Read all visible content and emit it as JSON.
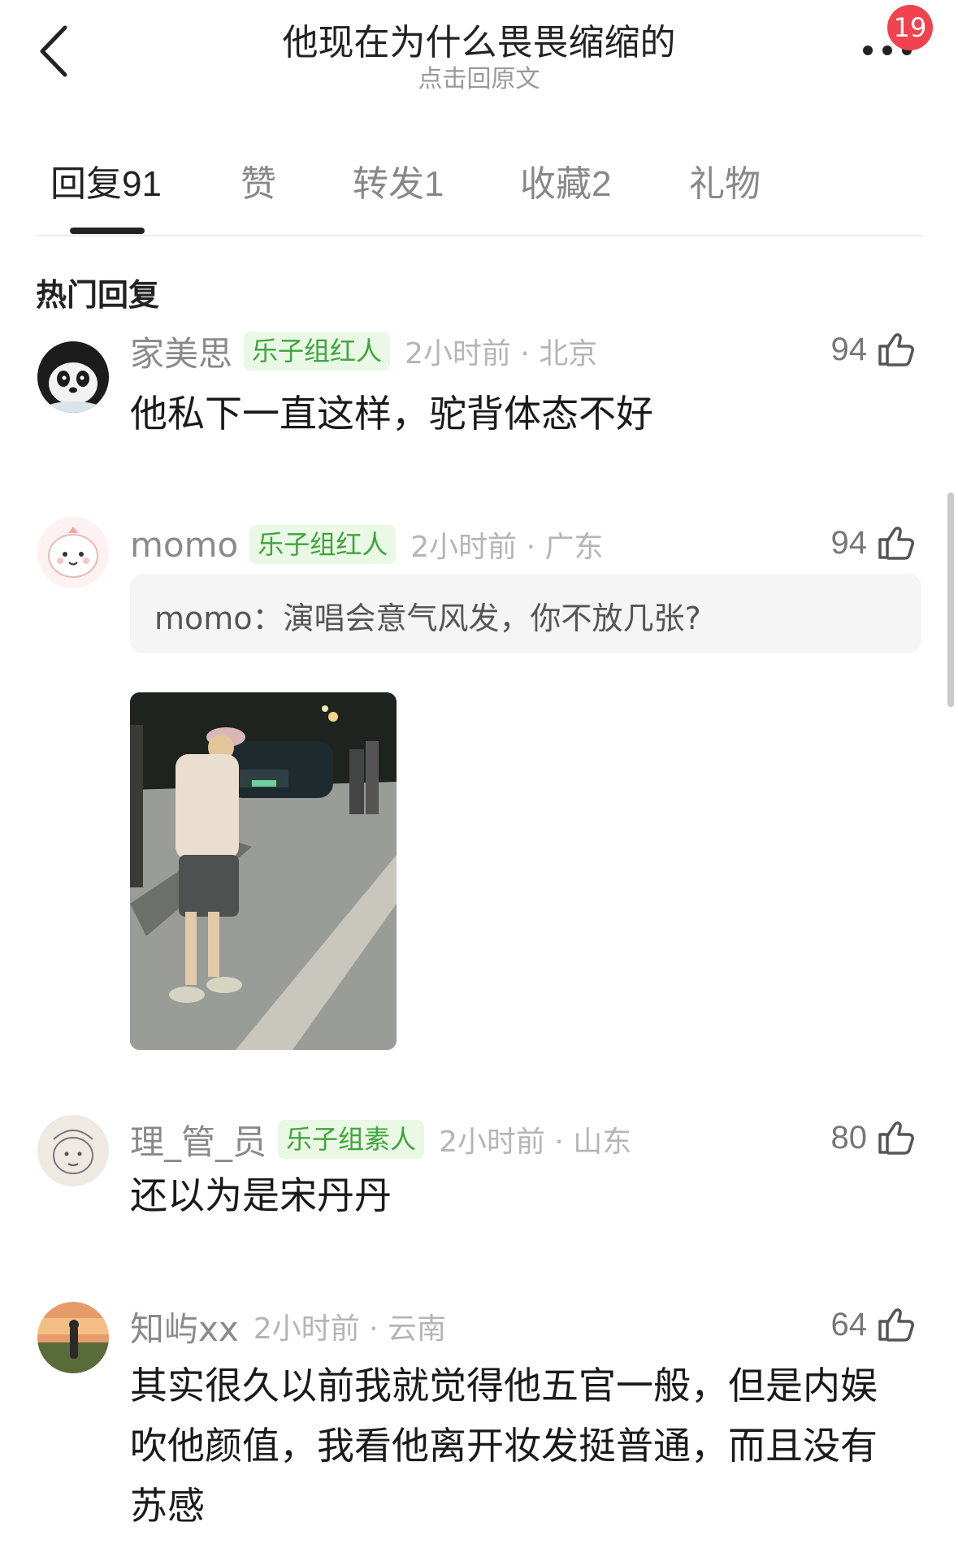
{
  "header": {
    "back_icon": "chevron-left-icon",
    "title": "他现在为什么畏畏缩缩的",
    "subtitle": "点击回原文",
    "more_icon": "more-dots-icon",
    "badge_count": "19"
  },
  "tabs": [
    {
      "label": "回复",
      "count": "91",
      "active": true
    },
    {
      "label": "赞",
      "count": "",
      "active": false
    },
    {
      "label": "转发",
      "count": "1",
      "active": false
    },
    {
      "label": "收藏",
      "count": "2",
      "active": false
    },
    {
      "label": "礼物",
      "count": "",
      "active": false
    }
  ],
  "section_title": "热门回复",
  "comments": [
    {
      "username": "家美思",
      "tag": "乐子组红人",
      "time_location": "2小时前 · 北京",
      "likes": "94",
      "text": "他私下一直这样，驼背体态不好",
      "avatar_icon": "panda-avatar"
    },
    {
      "username": "momo",
      "tag": "乐子组红人",
      "time_location": "2小时前 · 广东",
      "likes": "94",
      "quote": "momo：演唱会意气风发，你不放几张?",
      "avatar_icon": "cartoon-avatar",
      "photo": "street-photo"
    },
    {
      "username": "理_管_员",
      "tag": "乐子组素人",
      "time_location": "2小时前 · 山东",
      "likes": "80",
      "text": "还以为是宋丹丹",
      "avatar_icon": "sketch-avatar"
    },
    {
      "username": "知屿xx",
      "tag": "",
      "time_location": "2小时前 · 云南",
      "likes": "64",
      "text": "其实很久以前我就觉得他五官一般，但是内娱吹他颜值，我看他离开妆发挺普通，而且没有苏感",
      "avatar_icon": "sunset-avatar"
    }
  ],
  "colors": {
    "tag_bg": "#eaf8e6",
    "tag_text": "#3fa53c",
    "badge": "#f0434f"
  }
}
